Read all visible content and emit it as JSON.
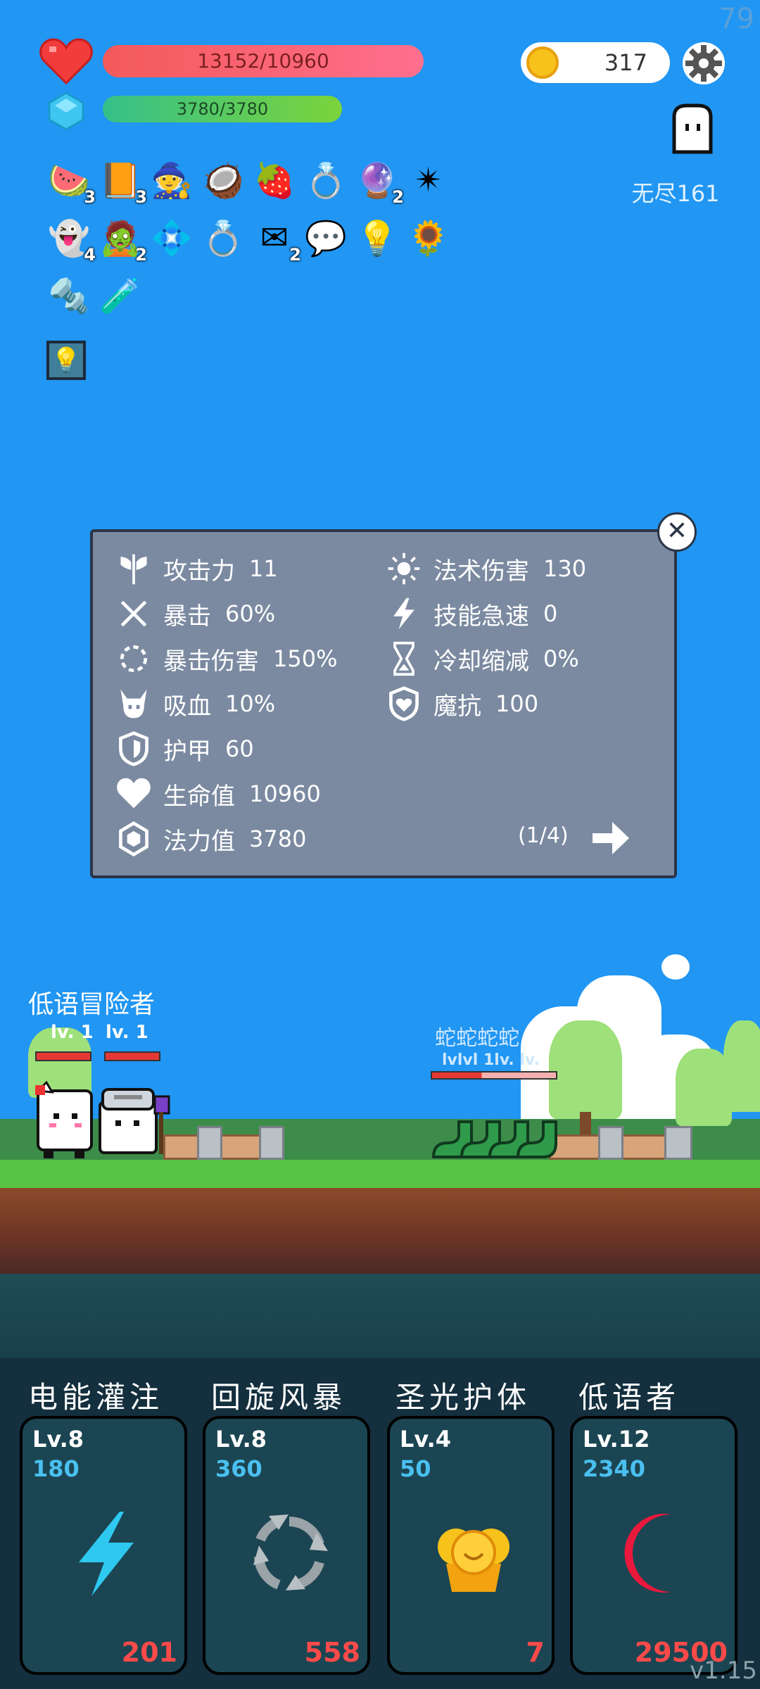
{
  "hud": {
    "fps": "79",
    "hp_text": "13152/10960",
    "mp_text": "3780/3780",
    "coins": "317",
    "endless_label": "无尽161"
  },
  "items": [
    {
      "icon": "watermelon-icon",
      "glyph": "🍉",
      "count": "3"
    },
    {
      "icon": "book-icon",
      "glyph": "📙",
      "count": "3"
    },
    {
      "icon": "wizard-hat-icon",
      "glyph": "🧙",
      "count": ""
    },
    {
      "icon": "coconut-icon",
      "glyph": "🥥",
      "count": ""
    },
    {
      "icon": "strawberry-icon",
      "glyph": "🍓",
      "count": ""
    },
    {
      "icon": "ring-icon",
      "glyph": "💍",
      "count": ""
    },
    {
      "icon": "crystal-ball-icon",
      "glyph": "🔮",
      "count": "2"
    },
    {
      "icon": "spiked-mace-icon",
      "glyph": "✴",
      "count": ""
    },
    {
      "icon": "ghost-icon",
      "glyph": "👻",
      "count": "4"
    },
    {
      "icon": "green-spirit-icon",
      "glyph": "🧟",
      "count": "2"
    },
    {
      "icon": "blue-gem-icon",
      "glyph": "💠",
      "count": ""
    },
    {
      "icon": "gold-ring-icon",
      "glyph": "💍",
      "count": ""
    },
    {
      "icon": "envelope-icon",
      "glyph": "✉",
      "count": "2"
    },
    {
      "icon": "speech-bubble-icon",
      "glyph": "💬",
      "count": ""
    },
    {
      "icon": "lightbulb-icon",
      "glyph": "💡",
      "count": ""
    },
    {
      "icon": "sunflower-icon",
      "glyph": "🌻",
      "count": ""
    },
    {
      "icon": "spiked-club-icon",
      "glyph": "🔩",
      "count": ""
    },
    {
      "icon": "potion-icon",
      "glyph": "🧪",
      "count": ""
    }
  ],
  "special_item": {
    "icon": "glowing-bulb-card-icon",
    "glyph": "💡"
  },
  "stats_left": [
    {
      "icon": "attack-icon",
      "label": "攻击力",
      "value": "11"
    },
    {
      "icon": "crit-icon",
      "label": "暴击",
      "value": "60%"
    },
    {
      "icon": "crit-damage-icon",
      "label": "暴击伤害",
      "value": "150%"
    },
    {
      "icon": "lifesteal-icon",
      "label": "吸血",
      "value": "10%"
    },
    {
      "icon": "armor-icon",
      "label": "护甲",
      "value": "60"
    },
    {
      "icon": "health-icon",
      "label": "生命值",
      "value": "10960"
    },
    {
      "icon": "mana-icon",
      "label": "法力值",
      "value": "3780"
    }
  ],
  "stats_right": [
    {
      "icon": "spell-damage-icon",
      "label": "法术伤害",
      "value": "130"
    },
    {
      "icon": "skill-haste-icon",
      "label": "技能急速",
      "value": "0"
    },
    {
      "icon": "cooldown-icon",
      "label": "冷却缩减",
      "value": "0%"
    },
    {
      "icon": "magic-resist-icon",
      "label": "魔抗",
      "value": "100"
    }
  ],
  "stats_page": "(1/4)",
  "heroes": {
    "name_overlap": "低语冒险者",
    "lv_a": "lv. 1",
    "lv_b": "lv. 1"
  },
  "enemies": {
    "name_overlap": "蛇蛇蛇蛇",
    "lv_overlap": "lvlvl 1lv. lv."
  },
  "skills": [
    {
      "name": "电能灌注",
      "level": "Lv.8",
      "cost": "180",
      "price": "201",
      "icon": "lightning-icon"
    },
    {
      "name": "回旋风暴",
      "level": "Lv.8",
      "cost": "360",
      "price": "558",
      "icon": "whirlwind-icon"
    },
    {
      "name": "圣光护体",
      "level": "Lv.4",
      "cost": "50",
      "price": "7",
      "icon": "holy-shield-icon"
    },
    {
      "name": "低语者",
      "level": "Lv.12",
      "cost": "2340",
      "price": "29500",
      "icon": "crescent-moon-icon"
    }
  ],
  "version": "v1.15",
  "colors": {
    "sky": "#2196f3",
    "hp_bar": "#f45a5a",
    "mp_bar": "#35c08a",
    "panel": "#7b8aa0",
    "skill_card": "#1b4552",
    "skill_cost": "#4ac0f0",
    "skill_price": "#ff4a4a"
  }
}
